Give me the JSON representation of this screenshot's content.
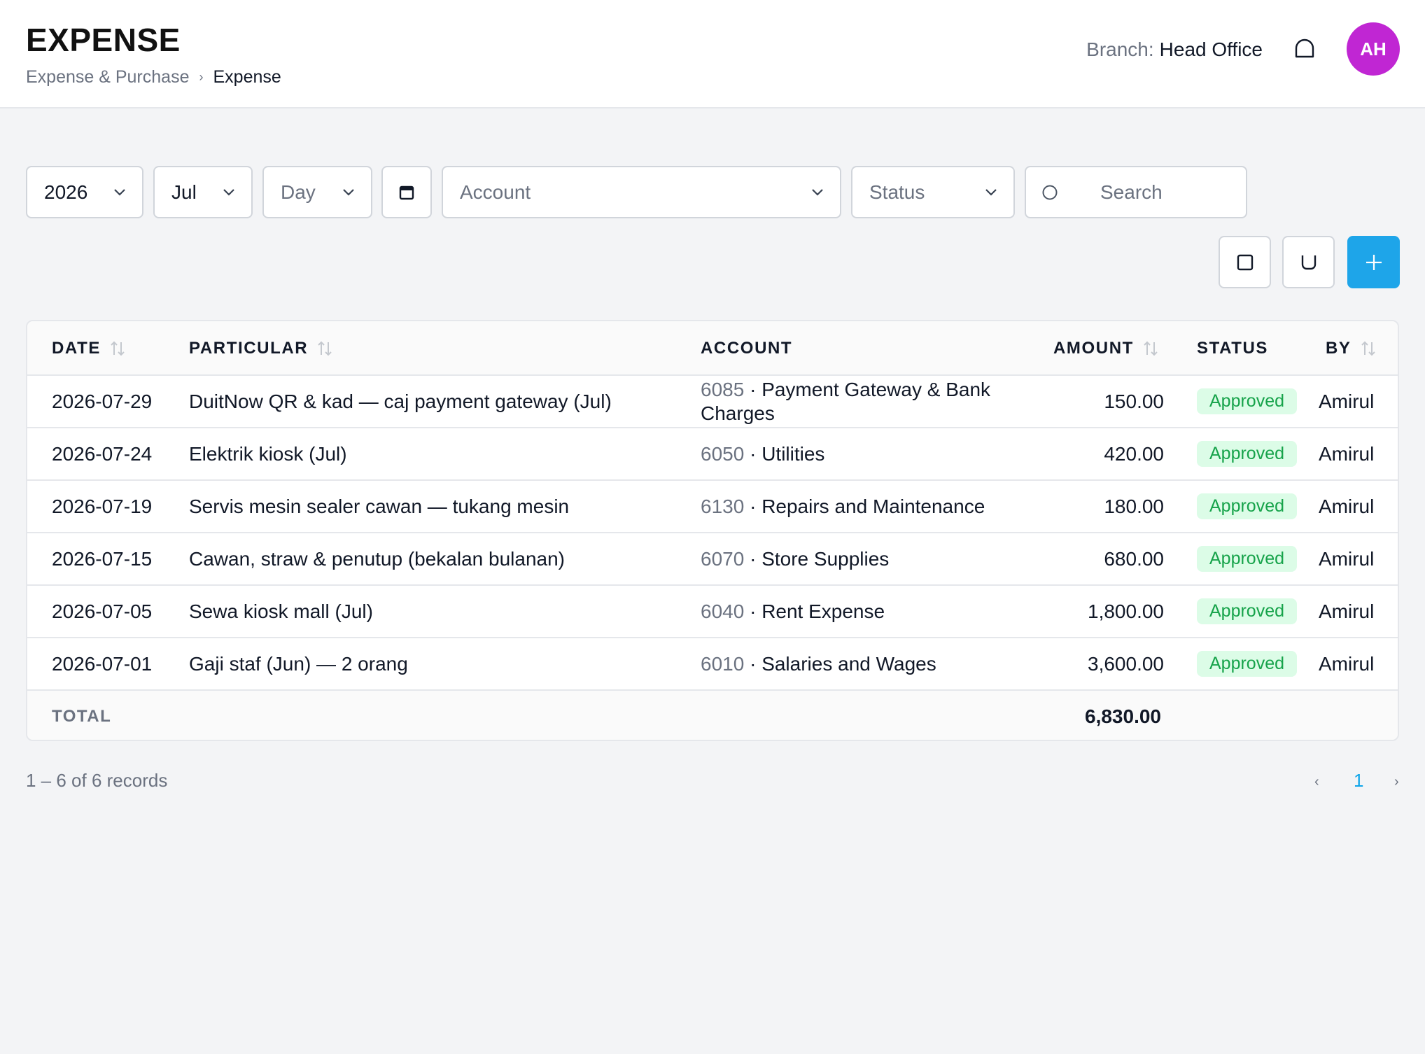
{
  "header": {
    "title": "EXPENSE",
    "breadcrumb": [
      "Expense & Purchase",
      "Expense"
    ],
    "branch_label": "Branch:",
    "branch_value": "Head Office",
    "avatar_initials": "AH",
    "avatar_color": "#c026d3"
  },
  "filters": {
    "year": "2026",
    "month": "Jul",
    "day_placeholder": "Day",
    "account_placeholder": "Account",
    "status_placeholder": "Status",
    "search_placeholder": "Search"
  },
  "table": {
    "columns": [
      "DATE",
      "PARTICULAR",
      "ACCOUNT",
      "AMOUNT",
      "STATUS",
      "BY"
    ],
    "rows": [
      {
        "date": "2026-07-29",
        "particular": "DuitNow QR & kad — caj payment gateway (Jul)",
        "account_code": "6085",
        "account_name": "Payment Gateway & Bank Charges",
        "amount": "150.00",
        "status": "Approved",
        "by": "Amirul"
      },
      {
        "date": "2026-07-24",
        "particular": "Elektrik kiosk (Jul)",
        "account_code": "6050",
        "account_name": "Utilities",
        "amount": "420.00",
        "status": "Approved",
        "by": "Amirul"
      },
      {
        "date": "2026-07-19",
        "particular": "Servis mesin sealer cawan — tukang mesin",
        "account_code": "6130",
        "account_name": "Repairs and Maintenance",
        "amount": "180.00",
        "status": "Approved",
        "by": "Amirul"
      },
      {
        "date": "2026-07-15",
        "particular": "Cawan, straw & penutup (bekalan bulanan)",
        "account_code": "6070",
        "account_name": "Store Supplies",
        "amount": "680.00",
        "status": "Approved",
        "by": "Amirul"
      },
      {
        "date": "2026-07-05",
        "particular": "Sewa kiosk mall (Jul)",
        "account_code": "6040",
        "account_name": "Rent Expense",
        "amount": "1,800.00",
        "status": "Approved",
        "by": "Amirul"
      },
      {
        "date": "2026-07-01",
        "particular": "Gaji staf (Jun) — 2 orang",
        "account_code": "6010",
        "account_name": "Salaries and Wages",
        "amount": "3,600.00",
        "status": "Approved",
        "by": "Amirul"
      }
    ],
    "total_label": "TOTAL",
    "total_value": "6,830.00"
  },
  "pagination": {
    "summary": "1 – 6 of 6 records",
    "prev": "‹",
    "current_page": "1",
    "next": "›"
  },
  "colors": {
    "accent": "#1ea5e9",
    "approved_bg": "#dcfce7",
    "approved_text": "#16a34a"
  },
  "icons": {
    "bell": "bell-icon",
    "calendar": "calendar-icon",
    "search": "search-icon",
    "export": "square-icon",
    "import": "cup-icon",
    "add": "plus-icon"
  }
}
